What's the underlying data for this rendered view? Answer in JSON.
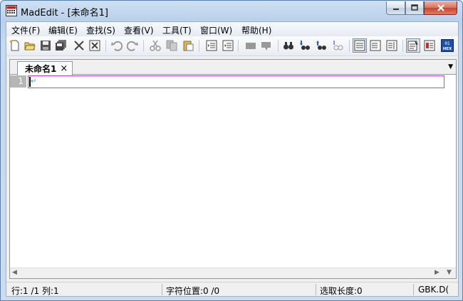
{
  "window": {
    "title": "MadEdit - [未命名1]",
    "controls": {
      "minimize": "min-icon",
      "maximize": "max-icon",
      "close": "close-icon"
    }
  },
  "menu": [
    "文件(F)",
    "编辑(E)",
    "查找(S)",
    "查看(V)",
    "工具(T)",
    "窗口(W)",
    "帮助(H)"
  ],
  "toolbar": {
    "buttons": [
      "new-file-icon",
      "open-file-icon",
      "save-icon",
      "save-all-icon",
      "close-icon",
      "close-all-icon",
      "undo-icon",
      "redo-icon",
      "cut-icon",
      "copy-icon",
      "paste-icon",
      "indent-icon",
      "unindent-icon",
      "comment-icon",
      "uncomment-icon",
      "find-icon",
      "find-next-icon",
      "find-previous-icon",
      "replace-icon",
      "wrap-none-icon",
      "wrap-window-icon",
      "wrap-column-icon",
      "text-mode-icon",
      "column-mode-icon",
      "hex-mode-icon"
    ],
    "hex_label": "HEX"
  },
  "document": {
    "tab_label": "未命名1",
    "tab_close": "×",
    "tab_menu": "▼",
    "line_number": "1",
    "newline_mark": "↵"
  },
  "scroll": {
    "left": "◀",
    "right": "▶",
    "drop": "▼"
  },
  "status": {
    "position": "行:1 /1 列:1",
    "char_position": "字符位置:0 /0",
    "selection": "选取长度:0",
    "encoding": "GBK.D("
  },
  "colors": {
    "accent_line_box": "#d23fc7",
    "gutter_bg": "#b6b6b6",
    "title_bg": "#b9d1ea"
  }
}
